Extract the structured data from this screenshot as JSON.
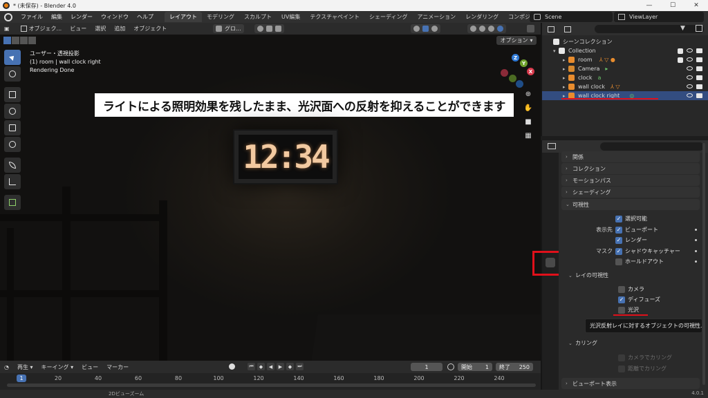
{
  "window": {
    "title": "* (未保存) - Blender 4.0",
    "min": "—",
    "max": "☐",
    "close": "✕"
  },
  "menu": {
    "items": [
      "ファイル",
      "編集",
      "レンダー",
      "ウィンドウ",
      "ヘルプ"
    ]
  },
  "workspaces": [
    "レイアウト",
    "モデリング",
    "スカルプト",
    "UV編集",
    "テクスチャペイント",
    "シェーディング",
    "アニメーション",
    "レンダリング",
    "コンポジティング"
  ],
  "scene": {
    "name": "Scene",
    "view_layer": "ViewLayer"
  },
  "vp_header": {
    "mode": "オブジェク...",
    "items": [
      "ビュー",
      "選択",
      "追加",
      "オブジェクト"
    ],
    "transform": "グロ..."
  },
  "viewport": {
    "info": [
      "ユーザー・透視投影",
      "(1) room | wall clock right",
      "Rendering Done"
    ],
    "caption": "ライトによる照明効果を残したまま、光沢面への反射を抑えることができます",
    "clock": "12:34",
    "options": "オプション"
  },
  "gizmo": {
    "x": "X",
    "y": "Y",
    "z": "Z"
  },
  "timeline": {
    "items": [
      "再生",
      "キーイング",
      "ビュー",
      "マーカー"
    ],
    "current_frame": "1",
    "start_label": "開始",
    "start": "1",
    "end_label": "終了",
    "end": "250",
    "ticks": [
      "1",
      "20",
      "40",
      "60",
      "80",
      "100",
      "120",
      "140",
      "160",
      "180",
      "200",
      "220",
      "240"
    ]
  },
  "status": {
    "middle": "2Dビューズーム",
    "version": "4.0.1"
  },
  "outliner": {
    "scene_collection": "シーンコレクション",
    "collection": "Collection",
    "rows": [
      {
        "name": "room",
        "color": "#e88c2e"
      },
      {
        "name": "Camera",
        "color": "#d6882e"
      },
      {
        "name": "clock",
        "color": "#e88c2e"
      },
      {
        "name": "wall clock",
        "color": "#e88c2e"
      },
      {
        "name": "wall clock right",
        "color": "#e88c2e"
      }
    ]
  },
  "properties": {
    "sections": [
      "関係",
      "コレクション",
      "モーションパス",
      "シェーディング",
      "可視性"
    ],
    "visibility": {
      "selectable": "選択可能",
      "show_in_label": "表示先",
      "viewport": "ビューポート",
      "render": "レンダー",
      "mask_label": "マスク",
      "shadow_catcher": "シャドウキャッチャー",
      "holdout": "ホールドアウト"
    },
    "ray_visibility": {
      "title": "レイの可視性",
      "camera": "カメラ",
      "diffuse": "ディフューズ",
      "glossy": "光沢"
    },
    "tooltip": "光沢反射レイに対するオブジェクトの可視性.",
    "culling": {
      "title": "カリング",
      "camera_cull": "カメラでカリング",
      "distance_cull": "距離でカリング"
    },
    "viewport_display": "ビューポート表示"
  },
  "colors": {
    "accent": "#4772b3",
    "highlight": "#e0101a",
    "selected_row": "#334d80"
  }
}
